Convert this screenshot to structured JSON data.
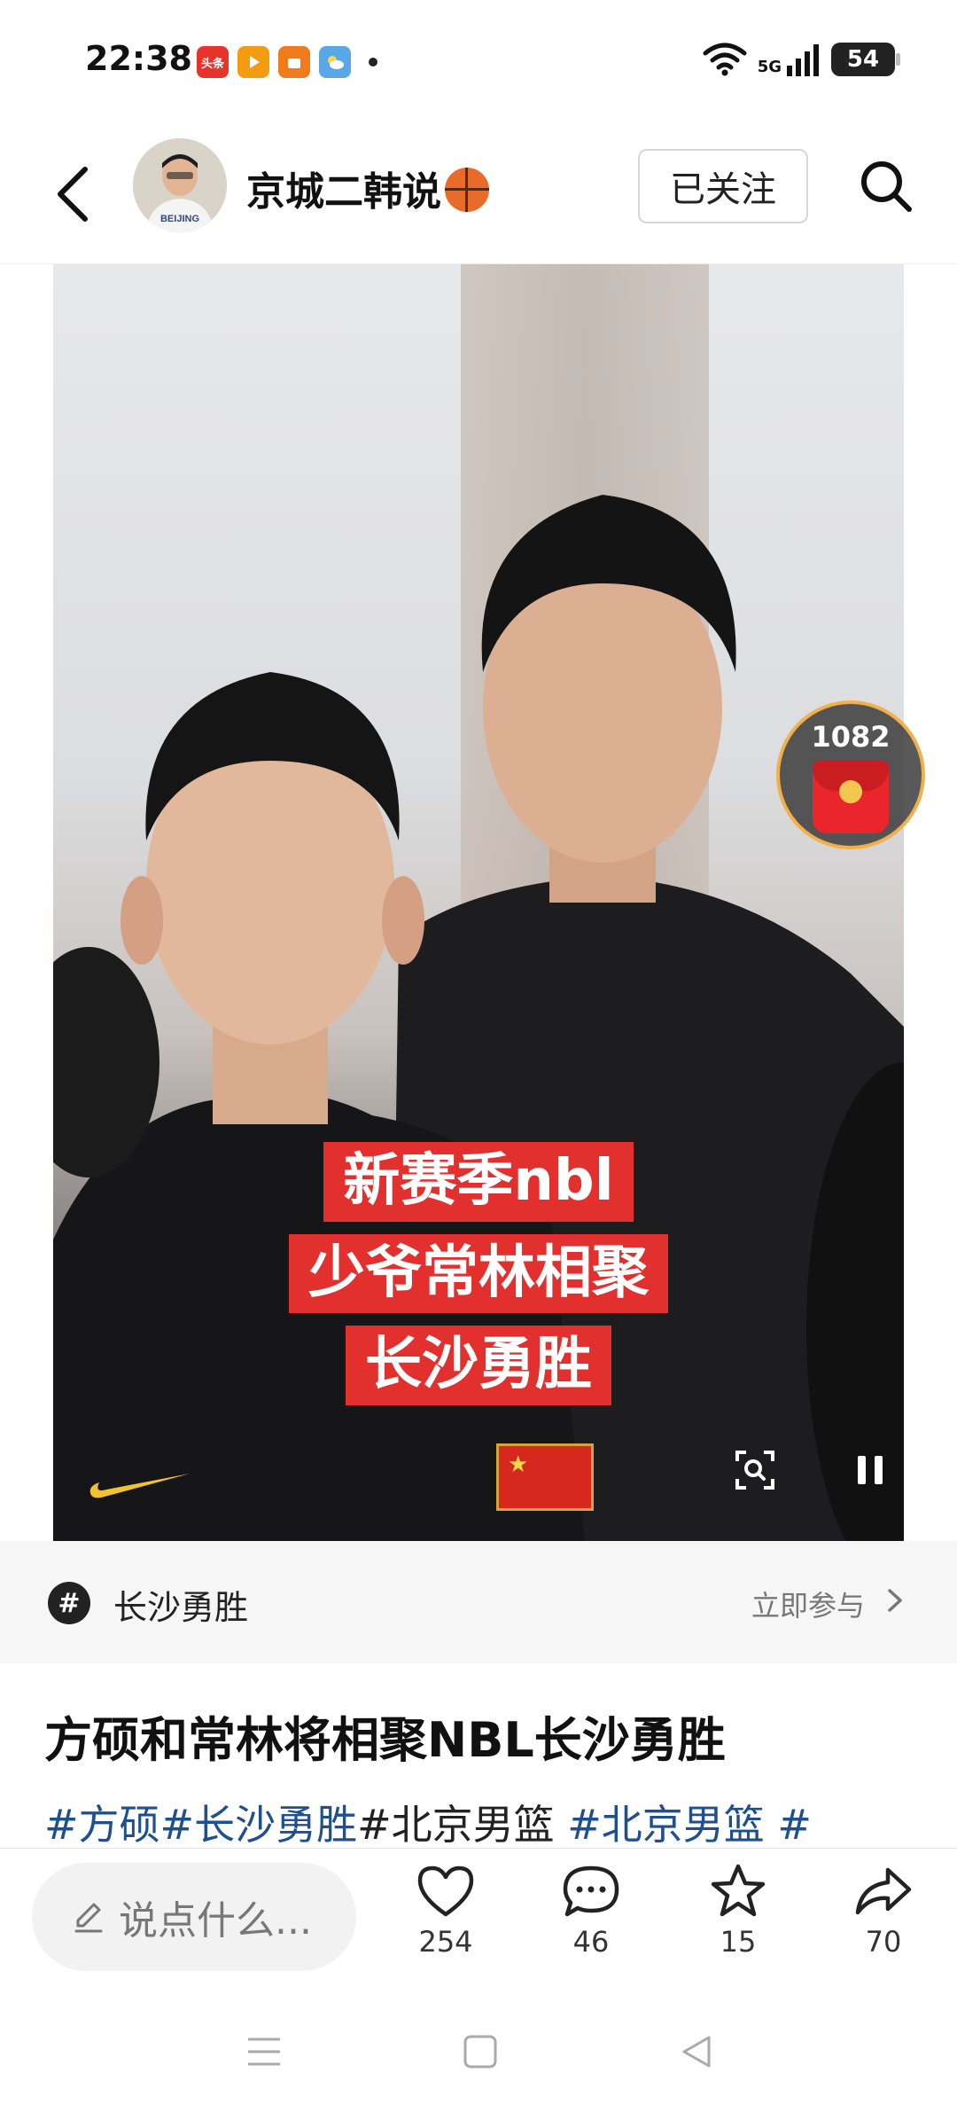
{
  "status_bar": {
    "time": "22:38",
    "app_icons": [
      {
        "name": "toutiao-icon",
        "label": "头条",
        "color": "#e8332b"
      },
      {
        "name": "video-app-icon",
        "label": "",
        "color": "#f39c12"
      },
      {
        "name": "store-app-icon",
        "label": "",
        "color": "#f07b1a"
      },
      {
        "name": "weather-app-icon",
        "label": "",
        "color": "#5aa7e8"
      }
    ],
    "network": "5G",
    "battery": "54"
  },
  "header": {
    "author_name": "京城二韩说",
    "follow_label": "已关注"
  },
  "video": {
    "captions": [
      "新赛季nbl",
      "少爷常林相聚",
      "长沙勇胜"
    ]
  },
  "red_packet": {
    "count": "1082"
  },
  "topic": {
    "name": "长沙勇胜",
    "join_label": "立即参与"
  },
  "post": {
    "title": "方硕和常林将相聚NBL长沙勇胜",
    "tags": [
      {
        "text": "#方硕",
        "link": true
      },
      {
        "text": "#长沙勇胜",
        "link": true
      },
      {
        "text": "#北京男篮 ",
        "link": false
      },
      {
        "text": "#北京男篮",
        "link": true
      },
      {
        "text": " #",
        "link": true
      }
    ]
  },
  "actions": {
    "comment_placeholder": "说点什么...",
    "likes": "254",
    "comments": "46",
    "favorites": "15",
    "shares": "70"
  },
  "colors": {
    "accent_link": "#1e4f8f",
    "caption_bg": "#e2302e",
    "red_packet": "#e8262b"
  }
}
